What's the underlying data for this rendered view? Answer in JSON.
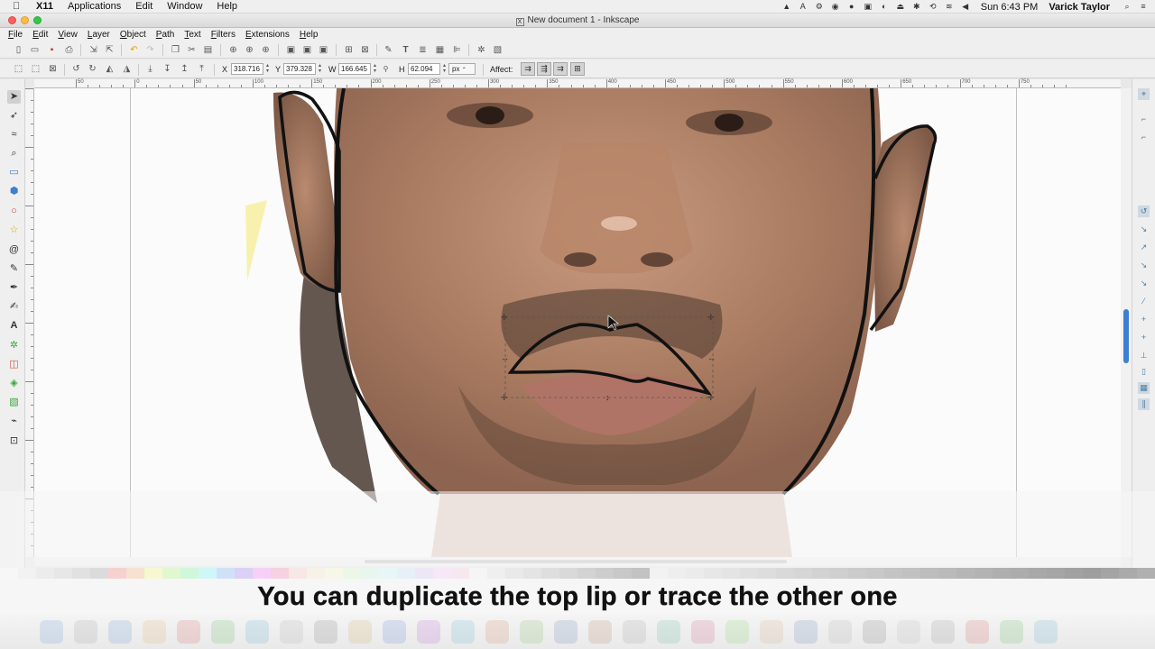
{
  "mac_menubar": {
    "apple": "",
    "app_name": "X11",
    "menus": [
      "Applications",
      "Edit",
      "Window",
      "Help"
    ],
    "clock": "Sun 6:43 PM",
    "user": "Varick Taylor"
  },
  "window": {
    "title": "New document 1 - Inkscape"
  },
  "app_menu": [
    "File",
    "Edit",
    "View",
    "Layer",
    "Object",
    "Path",
    "Text",
    "Filters",
    "Extensions",
    "Help"
  ],
  "tool_controls": {
    "x_label": "X",
    "x_value": "318.716",
    "y_label": "Y",
    "y_value": "379.328",
    "w_label": "W",
    "w_value": "166.645",
    "h_label": "H",
    "h_value": "62.094",
    "unit": "px",
    "affect_label": "Affect:"
  },
  "ruler": {
    "labels": [
      "50",
      "0",
      "50",
      "100",
      "150",
      "200",
      "250",
      "300",
      "350",
      "400",
      "450",
      "500",
      "550",
      "600",
      "650",
      "700",
      "750"
    ]
  },
  "subtitle": "You can duplicate the top lip or trace the other one",
  "colors": {
    "accent": "#3d7fd1",
    "stroke": "#111111",
    "skin": "#b98a6f"
  }
}
